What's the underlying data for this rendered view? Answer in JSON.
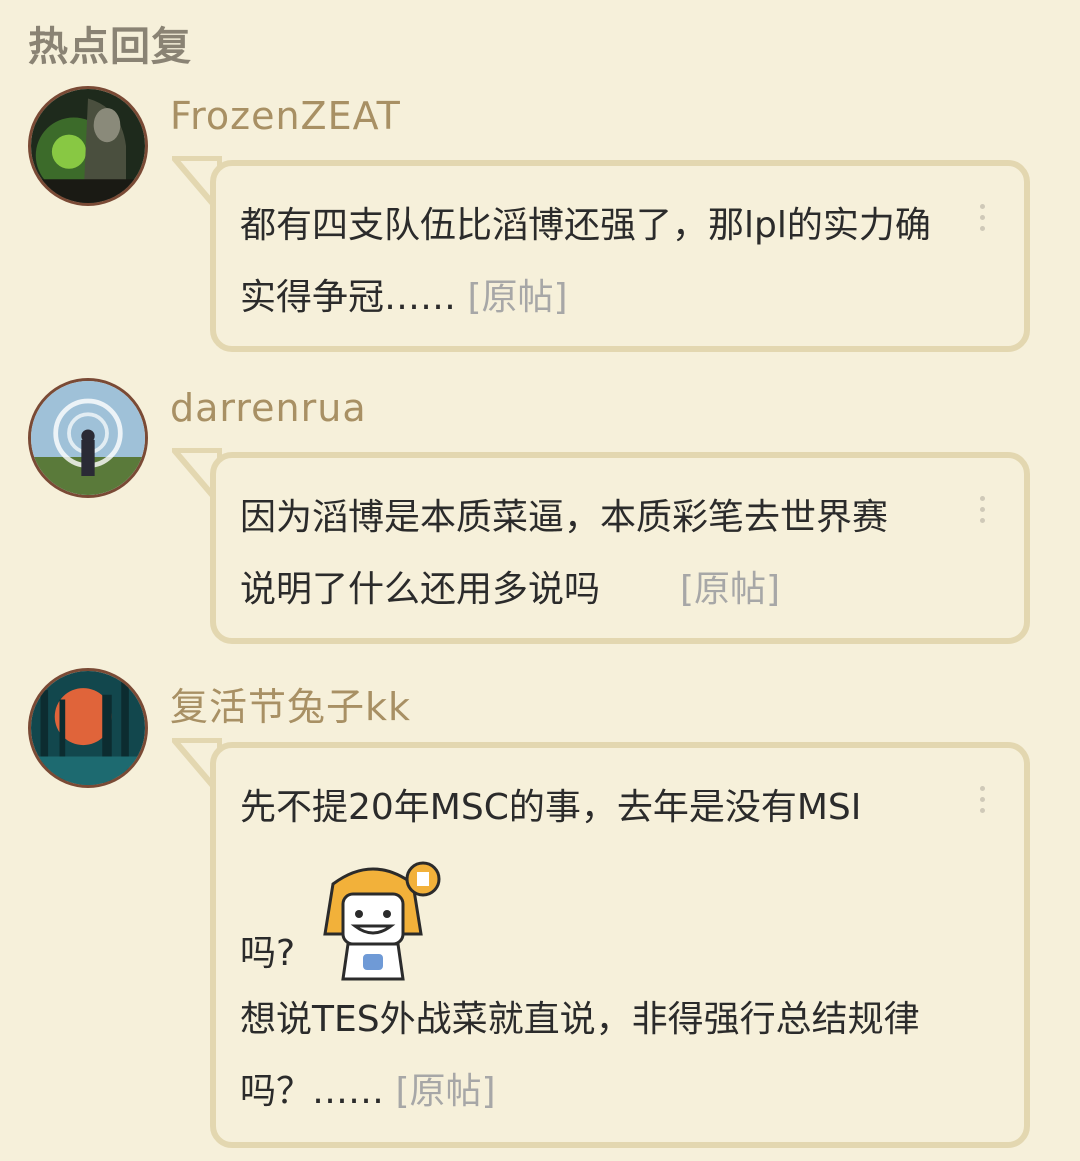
{
  "section": {
    "title": "热点回复"
  },
  "posts": [
    {
      "username": "FrozenZEAT",
      "text": "都有四支队伍比滔博还强了，那lpl的实力确实得争冠…… ",
      "link": "[原帖]"
    },
    {
      "username": "darrenrua",
      "line1": "因为滔博是本质菜逼，本质彩笔去世界赛",
      "line2": "说明了什么还用多说吗",
      "link": "[原帖]"
    },
    {
      "username": "复活节兔子kk",
      "line1": "先不提20年MSC的事，去年是没有MSI",
      "line2": "吗?",
      "line3": "想说TES外战菜就直说，非得强行总结规律",
      "line4": "吗？……",
      "link": "[原帖]"
    }
  ],
  "icons": {
    "more": "more-vertical-icon",
    "sticker": "smiling-cartoon-sticker"
  },
  "colors": {
    "background": "#f6f0da",
    "bubble_border": "#e3d7b0",
    "username": "#a89064",
    "link": "#a7a7a7"
  }
}
